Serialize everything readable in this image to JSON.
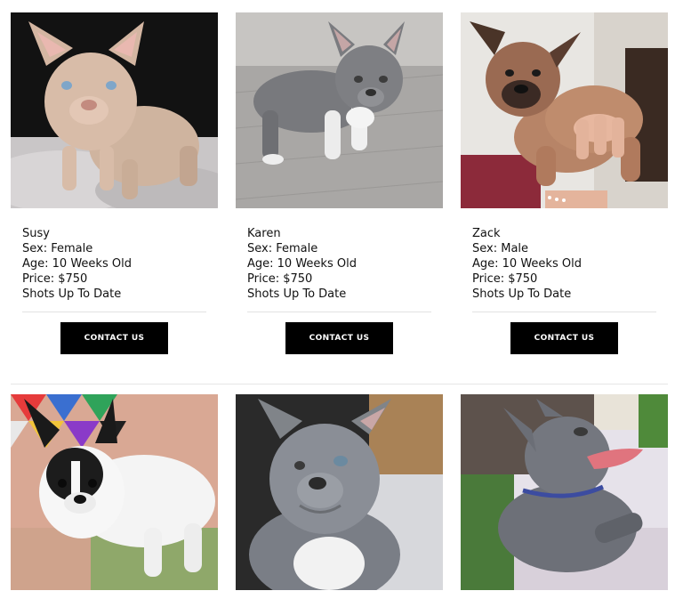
{
  "puppies": [
    {
      "name": "Susy",
      "sex": "Sex: Female",
      "age": "Age: 10 Weeks Old",
      "price": "Price: $750",
      "shots": "Shots Up To Date",
      "button": "CONTACT US"
    },
    {
      "name": "Karen",
      "sex": "Sex: Female",
      "age": "Age: 10 Weeks Old",
      "price": "Price: $750",
      "shots": "Shots Up To Date",
      "button": "CONTACT US"
    },
    {
      "name": "Zack",
      "sex": "Sex: Male",
      "age": "Age: 10 Weeks Old",
      "price": "Price: $750",
      "shots": "Shots Up To Date",
      "button": "CONTACT US"
    }
  ],
  "colors": {
    "button_bg": "#000000",
    "button_text": "#ffffff",
    "divider": "#e2e2e2"
  }
}
